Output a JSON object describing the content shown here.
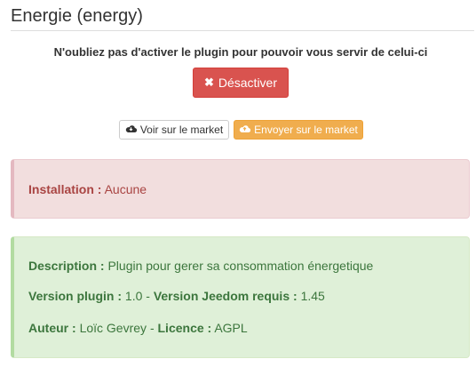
{
  "header": {
    "title": "Energie (energy)"
  },
  "notice": "N'oubliez pas d'activer le plugin pour pouvoir vous servir de celui-ci",
  "actions": {
    "deactivate_label": "Désactiver",
    "view_market_label": "Voir sur le market",
    "send_market_label": "Envoyer sur le market"
  },
  "installation": {
    "label": "Installation :",
    "value": "Aucune"
  },
  "info": {
    "description_label": "Description :",
    "description_value": "Plugin pour gerer sa consommation énergetique",
    "version_label": "Version plugin :",
    "version_value": "1.0",
    "separator": "-",
    "jeedom_label": "Version Jeedom requis :",
    "jeedom_value": "1.45",
    "author_label": "Auteur :",
    "author_value": "Loïc Gevrey",
    "license_label": "Licence :",
    "license_value": "AGPL"
  },
  "colors": {
    "danger_button": "#d9534f",
    "warning_button": "#f0ad4e",
    "danger_panel": "#f2dede",
    "success_panel": "#dff0d8"
  }
}
